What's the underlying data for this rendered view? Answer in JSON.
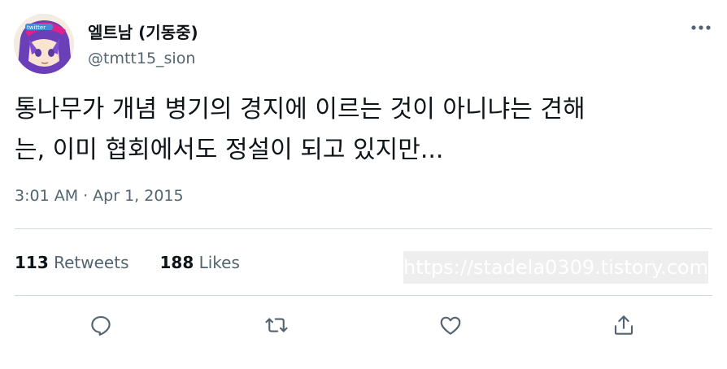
{
  "author": {
    "name": "엘트남 (기동중)",
    "handle": "@tmtt15_sion"
  },
  "avatar": {
    "icon": "anime-character-avatar",
    "badge_text": "twitter"
  },
  "more": {
    "icon": "more-horizontal-icon"
  },
  "tweet": {
    "text_lines": [
      "통나무가 개념 병기의 경지에 이르는 것이 아니냐는 견해",
      "는, 이미 협회에서도 정설이 되고 있지만..."
    ],
    "time": "3:01 AM",
    "separator": "·",
    "date": "Apr 1, 2015"
  },
  "stats": {
    "retweets_count": "113",
    "retweets_label": "Retweets",
    "likes_count": "188",
    "likes_label": "Likes"
  },
  "watermark": {
    "text": "https://stadela0309.tistory.com"
  },
  "actions": {
    "reply": "reply-icon",
    "retweet": "retweet-icon",
    "like": "heart-icon",
    "share": "share-icon"
  },
  "colors": {
    "text_primary": "#0f1419",
    "text_secondary": "#536471",
    "divider": "#cfd9de",
    "avatar_hair": "#6a3fb8",
    "avatar_cap": "#e0218a"
  }
}
